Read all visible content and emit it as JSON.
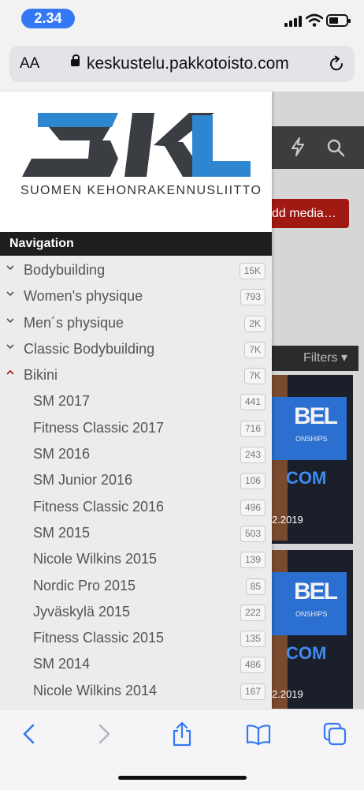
{
  "status": {
    "time": "2.34"
  },
  "browser": {
    "text_size_label": "AA",
    "url": "keskustelu.pakkotoisto.com"
  },
  "page": {
    "add_media_label": "dd media…",
    "filters_label": "Filters ▾",
    "photos": [
      {
        "banner": "BEL",
        "banner_sub": "ONSHIPS",
        "domain": "COM",
        "date": "2.2019"
      },
      {
        "banner": "BEL",
        "banner_sub": "ONSHIPS",
        "domain": "COM",
        "date": "2.2019"
      }
    ]
  },
  "drawer": {
    "logo_text": "SKL",
    "logo_subtitle": "SUOMEN KEHONRAKENNUSLIITTO",
    "heading": "Navigation",
    "items": [
      {
        "label": "Bodybuilding",
        "count": "15K",
        "level": 0,
        "state": "collapsed"
      },
      {
        "label": "Women's physique",
        "count": "793",
        "level": 0,
        "state": "collapsed"
      },
      {
        "label": "Men´s physique",
        "count": "2K",
        "level": 0,
        "state": "collapsed"
      },
      {
        "label": "Classic Bodybuilding",
        "count": "7K",
        "level": 0,
        "state": "collapsed"
      },
      {
        "label": "Bikini",
        "count": "7K",
        "level": 0,
        "state": "expanded"
      },
      {
        "label": "SM 2017",
        "count": "441",
        "level": 1
      },
      {
        "label": "Fitness Classic 2017",
        "count": "716",
        "level": 1
      },
      {
        "label": "SM 2016",
        "count": "243",
        "level": 1
      },
      {
        "label": "SM Junior 2016",
        "count": "106",
        "level": 1
      },
      {
        "label": "Fitness Classic 2016",
        "count": "496",
        "level": 1
      },
      {
        "label": "SM 2015",
        "count": "503",
        "level": 1
      },
      {
        "label": "Nicole Wilkins 2015",
        "count": "139",
        "level": 1
      },
      {
        "label": "Nordic Pro 2015",
        "count": "85",
        "level": 1
      },
      {
        "label": "Jyväskylä 2015",
        "count": "222",
        "level": 1
      },
      {
        "label": "Fitness Classic 2015",
        "count": "135",
        "level": 1
      },
      {
        "label": "SM 2014",
        "count": "486",
        "level": 1
      },
      {
        "label": "Nicole Wilkins 2014",
        "count": "167",
        "level": 1
      }
    ]
  },
  "colors": {
    "accent": "#3478f6",
    "brand_blue": "#2e86d0",
    "brand_dark": "#3a3d42",
    "button_red": "#a01912",
    "expanded_chevron": "#a01912"
  },
  "toolbar_icons": [
    "back-icon",
    "forward-icon",
    "share-icon",
    "bookmarks-icon",
    "tabs-icon"
  ]
}
